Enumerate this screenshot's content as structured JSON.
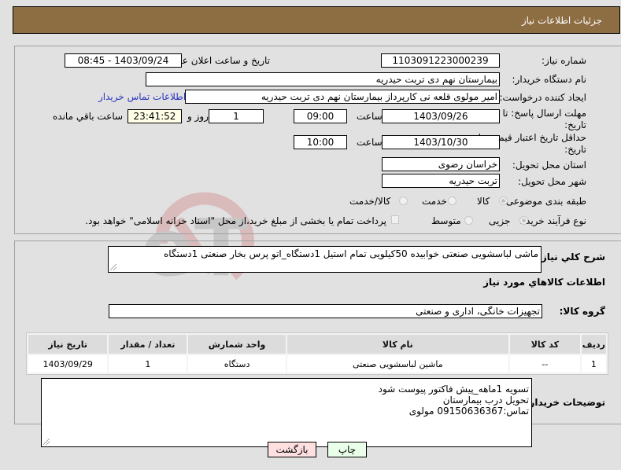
{
  "header": {
    "title": "جزئیات اطلاعات نیاز"
  },
  "form": {
    "need_number": {
      "label": "شماره نیاز:",
      "value": "1103091223000239"
    },
    "announce_datetime": {
      "label": "تاریخ و ساعت اعلان عمومی:",
      "value": "1403/09/24 - 08:45"
    },
    "buyer_org": {
      "label": "نام دستگاه خریدار:",
      "value": "بیمارستان نهم دی تربت حیدریه"
    },
    "requester": {
      "label": "ایجاد کننده درخواست:",
      "value": "امیر مولوی قلعه نی کارپرداز بیمارستان نهم دی تربت حیدریه"
    },
    "buyer_contact_link": "اطلاعات تماس خریدار",
    "response_deadline": {
      "label": "مهلت ارسال پاسخ: تا تاریخ:",
      "date": "1403/09/26",
      "time_label": "ساعت",
      "time": "09:00",
      "days": "1",
      "days_label": "روز و",
      "remaining": "23:41:52",
      "remaining_label": "ساعت باقي مانده"
    },
    "price_validity": {
      "label": "حداقل تاریخ اعتبار قیمت: تا تاریخ:",
      "date": "1403/10/30",
      "time_label": "ساعت",
      "time": "10:00"
    },
    "delivery_province": {
      "label": "استان محل تحویل:",
      "value": "خراسان رضوی"
    },
    "delivery_city": {
      "label": "شهر محل تحویل:",
      "value": "تربت حیدریه"
    },
    "category": {
      "label": "طبقه بندی موضوعی:",
      "options": [
        "کالا",
        "خدمت",
        "کالا/خدمت"
      ],
      "selected": "کالا"
    },
    "purchase_type": {
      "label": "نوع فرآیند خرید :",
      "options": [
        "جزیی",
        "متوسط"
      ],
      "selected": "جزیی",
      "payment_checkbox_label": "پرداخت تمام یا بخشی از مبلغ خرید،از محل \"اسناد خزانه اسلامی\" خواهد بود."
    }
  },
  "summary": {
    "label": "شرح کلي نياز:",
    "value": "ماشی لباسشویی صنعتی خوابیده 50کیلویی تمام استیل   1دستگاه_اتو پرس بخار صنعتی  1دستگاه"
  },
  "goods_section_title": "اطلاعات کالاهاي مورد نياز",
  "goods_group": {
    "label": "گروه کالا:",
    "value": "تجهیزات خانگی، اداری و صنعتی"
  },
  "items_table": {
    "columns": [
      "رديف",
      "کد کالا",
      "نام کالا",
      "واحد شمارش",
      "تعداد / مقدار",
      "تاريخ نياز"
    ],
    "rows": [
      [
        "1",
        "--",
        "ماشین لباسشویی صنعتی",
        "دستگاه",
        "1",
        "1403/09/29"
      ]
    ]
  },
  "buyer_notes": {
    "label": "توضیحات خریدار:",
    "lines": [
      "تسویه 1ماهه_پیش فاکتور پیوست شود",
      "تحویل درب بیمارستان",
      "تماس:09150636367 مولوی"
    ]
  },
  "buttons": {
    "print": "چاپ",
    "back": "بازگشت"
  },
  "colors": {
    "header_bg": "#8d6d42",
    "print_bg": "#eaffea",
    "back_bg": "#ffe0e0",
    "link": "#2a35c0"
  }
}
